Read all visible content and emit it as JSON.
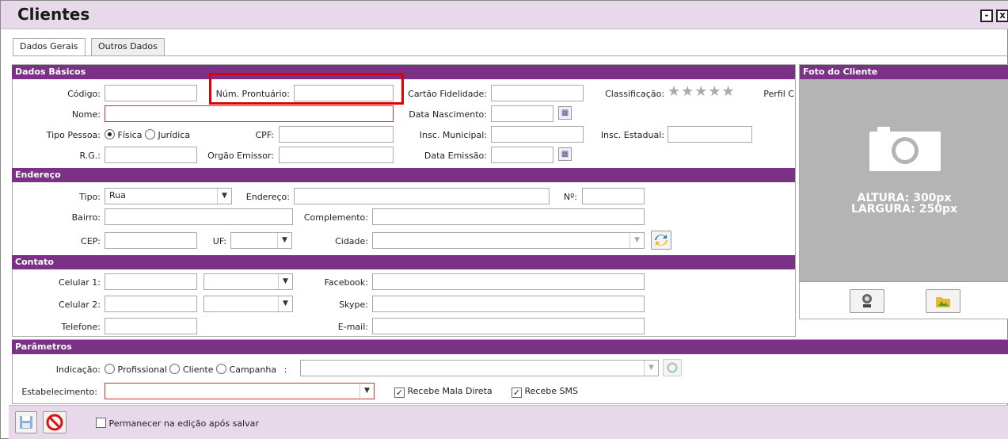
{
  "window": {
    "title": "Clientes",
    "minimize": "-",
    "close": "x"
  },
  "tabs": [
    {
      "label": "Dados Gerais"
    },
    {
      "label": "Outros Dados"
    }
  ],
  "sections": {
    "basic": "Dados Básicos",
    "address": "Endereço",
    "contact": "Contato",
    "params": "Parâmetros",
    "photo": "Foto do Cliente"
  },
  "basic": {
    "codigo": "Código:",
    "prontuario": "Núm. Prontuário:",
    "cartao": "Cartão Fidelidade:",
    "classificacao": "Classificação:",
    "stars": "★★★★★",
    "perfil": "Perfil C",
    "nome": "Nome:",
    "nascimento": "Data Nascimento:",
    "tipo_pessoa": "Tipo Pessoa:",
    "fisica": "Física",
    "juridica": "Jurídica",
    "cpf": "CPF:",
    "insc_municipal": "Insc. Municipal:",
    "insc_estadual": "Insc. Estadual:",
    "rg": "R.G.:",
    "orgao": "Orgão Emissor:",
    "emissao": "Data Emissão:"
  },
  "address": {
    "tipo": "Tipo:",
    "tipo_value": "Rua",
    "endereco": "Endereço:",
    "numero": "Nº:",
    "bairro": "Bairro:",
    "complemento": "Complemento:",
    "cep": "CEP:",
    "uf": "UF:",
    "cidade": "Cidade:"
  },
  "contact": {
    "celular1": "Celular 1:",
    "celular2": "Celular 2:",
    "telefone": "Telefone:",
    "facebook": "Facebook:",
    "skype": "Skype:",
    "email": "E-mail:"
  },
  "params": {
    "indicacao": "Indicação:",
    "profissional": "Profissional",
    "cliente": "Cliente",
    "campanha": "Campanha",
    "sep": ":",
    "estabelecimento": "Estabelecimento:",
    "mala_direta": "Recebe Mala Direta",
    "sms": "Recebe SMS"
  },
  "photo": {
    "altura": "ALTURA: 300px",
    "largura": "LARGURA: 250px"
  },
  "footer": {
    "permanecer": "Permanecer na edição após salvar"
  },
  "colors": {
    "section": "#7b3185",
    "titlebar": "#e8d9ea",
    "highlight": "#e00000",
    "photo_bg": "#b4b4b4"
  }
}
